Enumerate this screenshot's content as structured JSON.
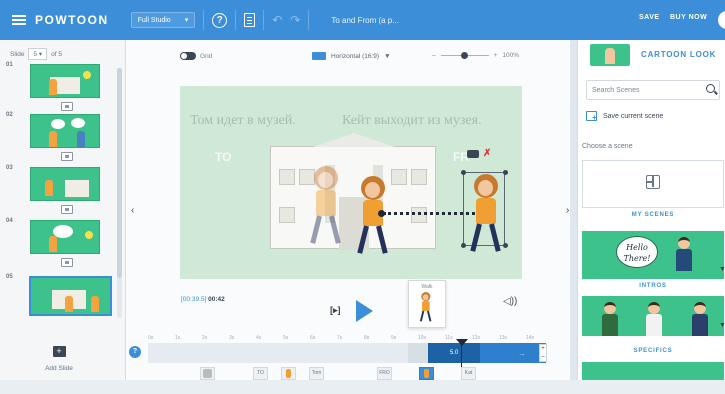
{
  "topbar": {
    "brand": "POWTOON",
    "studio": "Full Studio",
    "studio_caret": "▾",
    "help": "?",
    "undo": "↶",
    "redo": "↷",
    "title": "To and From (a p...",
    "save": "SAVE",
    "buy": "BUY NOW"
  },
  "slides": {
    "label": "Slide",
    "current": "5",
    "caret": "▾",
    "total": "of 5",
    "items": [
      {
        "num": "01"
      },
      {
        "num": "02"
      },
      {
        "num": "03"
      },
      {
        "num": "04"
      },
      {
        "num": "05"
      }
    ],
    "add_label": "Add Slide",
    "add_icon": "+"
  },
  "toolbar": {
    "grid": "Grid",
    "orientation": "Horizontal (16:9)",
    "orientation_caret": "▼",
    "zoom_minus": "–",
    "zoom_plus": "+",
    "zoom": "100%"
  },
  "canvas": {
    "text_left": "Том идет в музей.",
    "text_right": "Кейт выходит из музея.",
    "to": "TO",
    "from": "FR",
    "cam_off": "✗",
    "collapse_left": "‹",
    "collapse_right": "›"
  },
  "playback": {
    "time_current": "[00:39.5]",
    "time_total": "00:42",
    "frame": "[▸]",
    "popup_label": "Walk",
    "volume": "◁))"
  },
  "timeline": {
    "ticks": [
      "0s",
      "1s",
      "2s",
      "3s",
      "4s",
      "5s",
      "6s",
      "7s",
      "8s",
      "9s",
      "10s",
      "11s",
      "12s",
      "13s",
      "14s"
    ],
    "scene_label": "5.0",
    "info": "?",
    "zoom_plus": "+",
    "zoom_minus": "–",
    "arrow": "→",
    "objects": [
      "TO",
      "Tom",
      "FRO",
      "Kat"
    ]
  },
  "right": {
    "look": "CARTOON LOOK",
    "search_placeholder": "Search Scenes",
    "save_current": "Save current scene",
    "choose": "Choose a scene",
    "my_scenes": "MY SCENES",
    "intros": "INTROS",
    "specifics": "SPECIFICS",
    "hello": "Hello There!",
    "caret": "▼"
  },
  "colors": {
    "accent": "#3d8ed9",
    "scene_green": "#3cc28a",
    "canvas_bg": "#cfe9d6"
  }
}
